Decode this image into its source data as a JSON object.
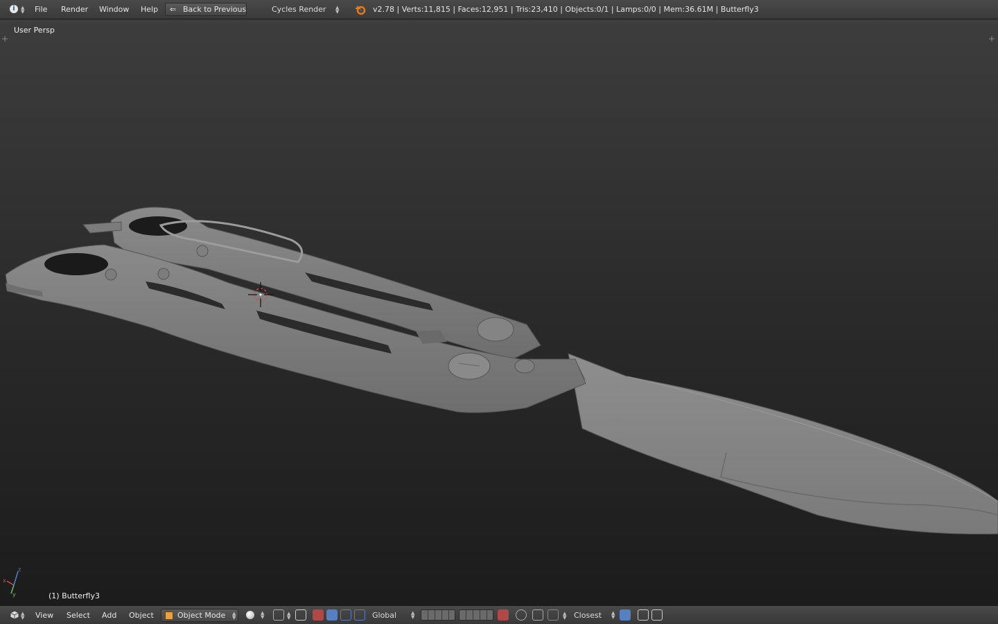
{
  "top": {
    "menus": [
      "File",
      "Render",
      "Window",
      "Help"
    ],
    "back_button": "Back to Previous",
    "render_engine": "Cycles Render",
    "stats": "v2.78 | Verts:11,815 | Faces:12,951 | Tris:23,410 | Objects:0/1 | Lamps:0/0 | Mem:36.61M | Butterfly3"
  },
  "viewport": {
    "view_label": "User Persp",
    "object_label": "(1) Butterfly3"
  },
  "bottom": {
    "menus": [
      "View",
      "Select",
      "Add",
      "Object"
    ],
    "mode": "Object Mode",
    "orientation": "Global",
    "snap_target": "Closest"
  },
  "colors": {
    "accent_red": "#b04848",
    "accent_blue": "#5680c2",
    "model_gray": "#858585"
  }
}
